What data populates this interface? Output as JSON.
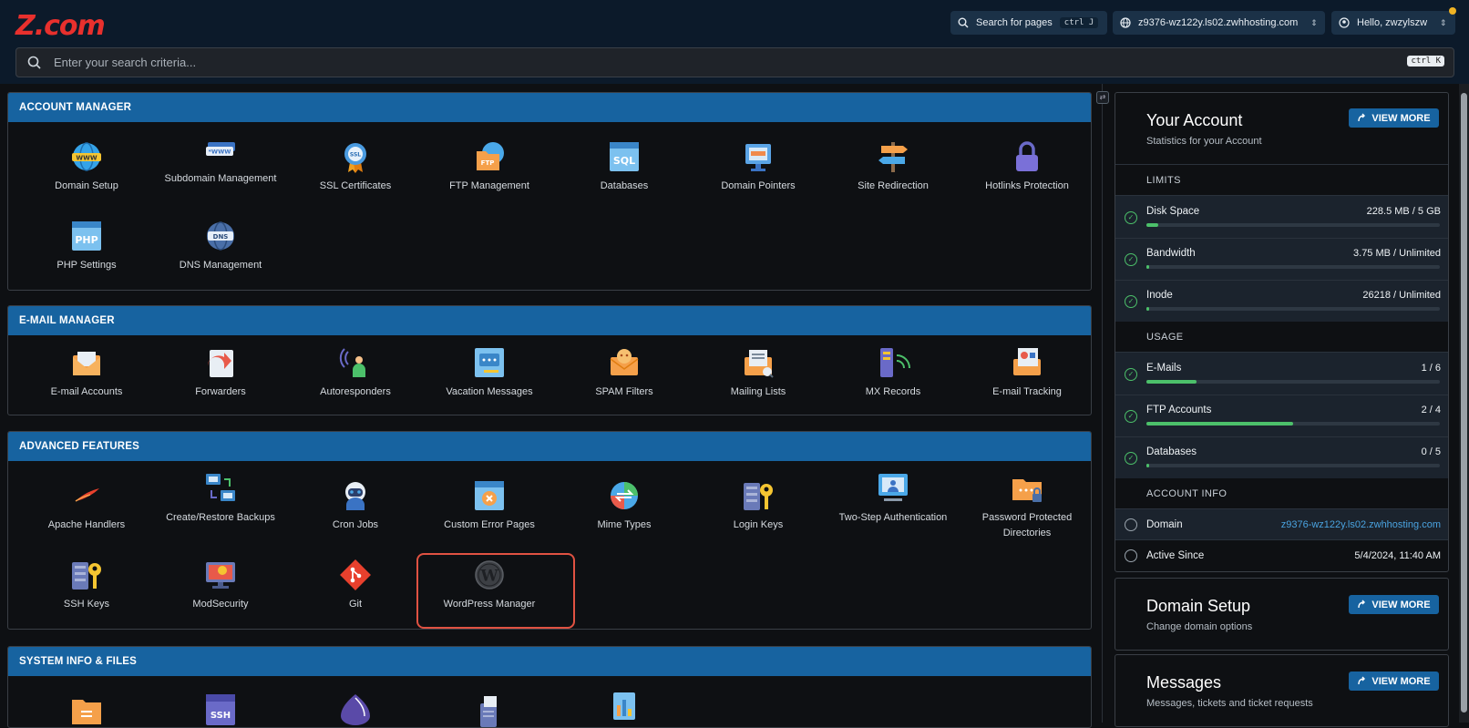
{
  "brand": {
    "logo_text": "Z.com"
  },
  "header": {
    "search_pages_label": "Search for pages",
    "search_pages_shortcut": "ctrl J",
    "domain_selector": "z9376-wz122y.ls02.zwhhosting.com",
    "user_greeting": "Hello, zwzylszw"
  },
  "search": {
    "placeholder": "Enter your search criteria...",
    "shortcut": "ctrl K"
  },
  "sections": [
    {
      "title": "ACCOUNT MANAGER",
      "items": [
        {
          "label": "Domain Setup",
          "icon": "globe-www-icon"
        },
        {
          "label": "Subdomain Management",
          "icon": "subdomain-www-icon"
        },
        {
          "label": "SSL Certificates",
          "icon": "ssl-badge-icon"
        },
        {
          "label": "FTP Management",
          "icon": "ftp-folder-icon"
        },
        {
          "label": "Databases",
          "icon": "sql-database-icon"
        },
        {
          "label": "Domain Pointers",
          "icon": "domain-pointer-icon"
        },
        {
          "label": "Site Redirection",
          "icon": "signpost-icon"
        },
        {
          "label": "Hotlinks Protection",
          "icon": "padlock-icon"
        },
        {
          "label": "PHP Settings",
          "icon": "php-window-icon"
        },
        {
          "label": "DNS Management",
          "icon": "dns-globe-icon"
        }
      ]
    },
    {
      "title": "E-MAIL MANAGER",
      "items": [
        {
          "label": "E-mail Accounts",
          "icon": "email-envelope-icon"
        },
        {
          "label": "Forwarders",
          "icon": "forward-arrow-icon"
        },
        {
          "label": "Autoresponders",
          "icon": "autoresponder-person-icon"
        },
        {
          "label": "Vacation Messages",
          "icon": "vacation-message-icon"
        },
        {
          "label": "SPAM Filters",
          "icon": "spam-filter-icon"
        },
        {
          "label": "Mailing Lists",
          "icon": "mailing-list-icon"
        },
        {
          "label": "MX Records",
          "icon": "mx-records-icon"
        },
        {
          "label": "E-mail Tracking",
          "icon": "email-tracking-icon"
        }
      ]
    },
    {
      "title": "ADVANCED FEATURES",
      "items": [
        {
          "label": "Apache Handlers",
          "icon": "apache-feather-icon"
        },
        {
          "label": "Create/Restore Backups",
          "icon": "backup-computers-icon"
        },
        {
          "label": "Cron Jobs",
          "icon": "cron-robot-icon"
        },
        {
          "label": "Custom Error Pages",
          "icon": "error-page-icon"
        },
        {
          "label": "Mime Types",
          "icon": "mime-types-icon"
        },
        {
          "label": "Login Keys",
          "icon": "login-keys-icon"
        },
        {
          "label": "Two-Step Authentication",
          "icon": "two-step-auth-icon"
        },
        {
          "label": "Password Protected Directories",
          "icon": "protected-folder-icon"
        },
        {
          "label": "SSH Keys",
          "icon": "ssh-keys-icon"
        },
        {
          "label": "ModSecurity",
          "icon": "modsecurity-monitor-icon"
        },
        {
          "label": "Git",
          "icon": "git-icon"
        },
        {
          "label": "WordPress Manager",
          "icon": "wordpress-icon"
        }
      ]
    },
    {
      "title": "SYSTEM INFO & FILES",
      "items": [
        {
          "label": "",
          "icon": "file-folder-icon"
        },
        {
          "label": "",
          "icon": "ssh-terminal-icon"
        },
        {
          "label": "",
          "icon": "perl-onion-icon"
        },
        {
          "label": "",
          "icon": "server-tower-icon"
        },
        {
          "label": "",
          "icon": "stats-clipboard-icon"
        }
      ]
    }
  ],
  "account_card": {
    "title": "Your Account",
    "subtitle": "Statistics for your Account",
    "view_more": "VIEW MORE",
    "limits_label": "LIMITS",
    "limits": [
      {
        "name": "Disk Space",
        "value": "228.5 MB / 5 GB",
        "fill_percent": 4
      },
      {
        "name": "Bandwidth",
        "value": "3.75 MB / Unlimited",
        "fill_percent": 1
      },
      {
        "name": "Inode",
        "value": "26218 / Unlimited",
        "fill_percent": 1
      }
    ],
    "usage_label": "USAGE",
    "usage": [
      {
        "name": "E-Mails",
        "value": "1 / 6",
        "fill_percent": 17
      },
      {
        "name": "FTP Accounts",
        "value": "2 / 4",
        "fill_percent": 50
      },
      {
        "name": "Databases",
        "value": "0 / 5",
        "fill_percent": 1
      }
    ],
    "info_label": "ACCOUNT INFO",
    "domain_label": "Domain",
    "domain_value": "z9376-wz122y.ls02.zwhhosting.com",
    "active_since_label": "Active Since",
    "active_since_value": "5/4/2024, 11:40 AM"
  },
  "domain_card": {
    "title": "Domain Setup",
    "subtitle": "Change domain options",
    "view_more": "VIEW MORE"
  },
  "messages_card": {
    "title": "Messages",
    "subtitle": "Messages, tickets and ticket requests",
    "view_more": "VIEW MORE"
  },
  "colors": {
    "accent": "#1763a0",
    "brand_red": "#e8302d",
    "success": "#4cc06a",
    "highlight": "#e05242",
    "link": "#4aa3e0"
  }
}
